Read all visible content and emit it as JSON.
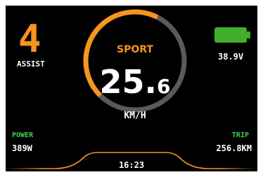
{
  "assist": {
    "level": "4",
    "label": "ASSIST"
  },
  "battery": {
    "level_fraction": 0.85,
    "voltage": "38.9V",
    "color": "#3fae2a"
  },
  "mode": "SPORT",
  "speed": {
    "integer": "25",
    "dot": ".",
    "decimal": "6",
    "unit": "KM/H",
    "arc_fraction": 0.6
  },
  "power": {
    "label": "POWER",
    "value": "389W"
  },
  "trip": {
    "label": "TRIP",
    "value": "256.8KM"
  },
  "clock": "16:23",
  "colors": {
    "accent": "#f7941d",
    "green": "#39d353",
    "track": "#5a5a5a",
    "background": "#000000"
  },
  "icons": [
    "battery-icon"
  ]
}
